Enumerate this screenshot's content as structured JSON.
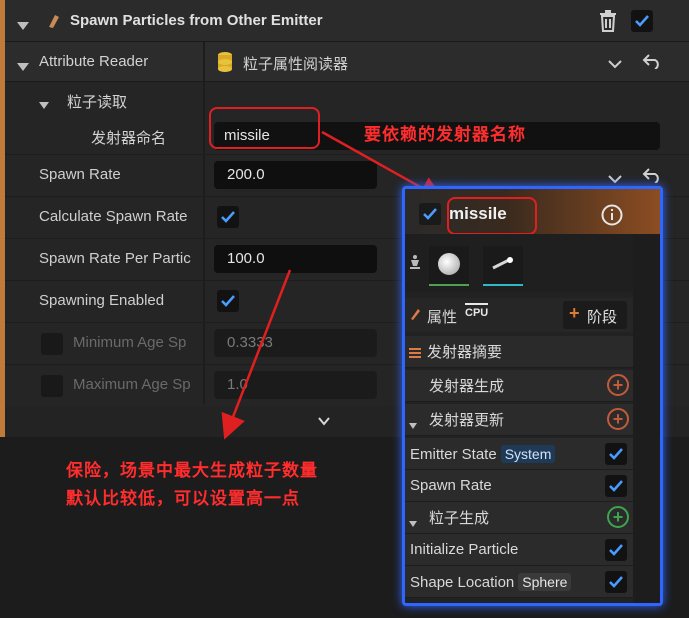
{
  "header": {
    "title": "Spawn Particles from Other Emitter"
  },
  "attribute_reader": {
    "label": "Attribute Reader",
    "value": "粒子属性阅读器"
  },
  "particle_read": {
    "label": "粒子读取"
  },
  "emitter_name": {
    "label": "发射器命名",
    "value": "missile"
  },
  "properties": [
    {
      "label": "Spawn Rate",
      "value": "200.0"
    },
    {
      "label": "Calculate Spawn Rate"
    },
    {
      "label": "Spawn Rate Per Partic",
      "value": "100.0"
    },
    {
      "label": "Spawning Enabled"
    },
    {
      "label": "Minimum Age Sp",
      "value": "0.3333"
    },
    {
      "label": "Maximum Age Sp",
      "value": "1.0"
    }
  ],
  "annotations": {
    "emitter_note": "要依赖的发射器名称",
    "spawn_note_line1": "保险，场景中最大生成粒子数量",
    "spawn_note_line2": "默认比较低，可以设置高一点"
  },
  "emitter_node": {
    "title": "missile",
    "attributes_label": "属性",
    "cpu_label": "CPU",
    "stage_label": "阶段",
    "summary_label": "发射器摘要",
    "emitter_spawn_label": "发射器生成",
    "emitter_update_label": "发射器更新",
    "emitter_state_label": "Emitter State",
    "emitter_state_badge": "System",
    "spawn_rate_label": "Spawn Rate",
    "particle_spawn_label": "粒子生成",
    "initialize_particle_label": "Initialize Particle",
    "shape_location_label": "Shape Location",
    "shape_location_badge": "Sphere"
  },
  "colors": {
    "accent": "#c07a3a",
    "checkbox_blue": "#4a9cff",
    "annotation_red": "#ff2d2d",
    "node_border": "#2f66ff"
  }
}
